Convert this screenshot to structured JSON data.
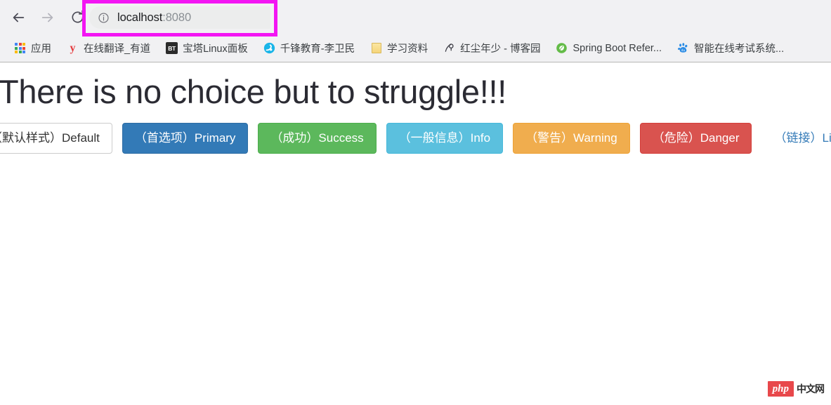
{
  "browser": {
    "nav": {
      "back_icon": "arrow-left-icon",
      "forward_icon": "arrow-right-icon",
      "reload_icon": "reload-icon"
    },
    "omnibox": {
      "info_icon": "info-circle-icon",
      "host": "localhost",
      "port": ":8080",
      "full_url": "localhost:8080",
      "highlight_color": "#f315f3"
    },
    "bookmarks": [
      {
        "icon": "apps-grid-icon",
        "label": "应用"
      },
      {
        "icon": "youdao-icon",
        "label": "在线翻译_有道"
      },
      {
        "icon": "bt-panel-icon",
        "label": "宝塔Linux面板"
      },
      {
        "icon": "qianfeng-icon",
        "label": "千锋教育-李卫民"
      },
      {
        "icon": "folder-icon",
        "label": "学习资料"
      },
      {
        "icon": "cnblogs-icon",
        "label": "红尘年少 - 博客园"
      },
      {
        "icon": "spring-leaf-icon",
        "label": "Spring Boot Refer..."
      },
      {
        "icon": "baidu-paw-icon",
        "label": "智能在线考试系统..."
      }
    ]
  },
  "page": {
    "heading": "There is no choice but to struggle!!!",
    "buttons": [
      {
        "label": "（默认样式）Default",
        "style": "btn-default",
        "color": "#ffffff"
      },
      {
        "label": "（首选项）Primary",
        "style": "btn-primary",
        "color": "#337ab7"
      },
      {
        "label": "（成功）Success",
        "style": "btn-success",
        "color": "#5cb85c"
      },
      {
        "label": "（一般信息）Info",
        "style": "btn-info",
        "color": "#5bc0de"
      },
      {
        "label": "（警告）Warning",
        "style": "btn-warning",
        "color": "#f0ad4e"
      },
      {
        "label": "（危险）Danger",
        "style": "btn-danger",
        "color": "#d9534f"
      },
      {
        "label": "（链接）Link",
        "style": "btn-link",
        "color": "#337ab7"
      }
    ],
    "watermark": {
      "badge": "php",
      "text": "中文网"
    }
  }
}
